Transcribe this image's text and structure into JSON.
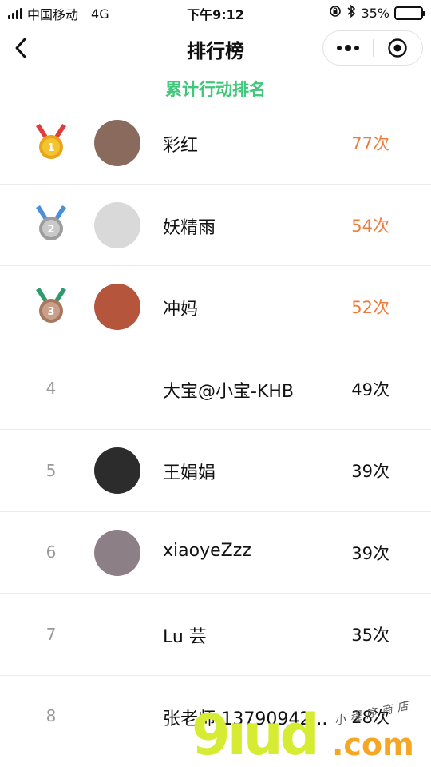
{
  "status_bar": {
    "carrier": "中国移动",
    "network": "4G",
    "time": "下午9:12",
    "battery_percent": "35%",
    "battery_level": 0.35
  },
  "nav": {
    "title": "排行榜",
    "back_icon": "chevron-left-icon",
    "more_icon": "more-dots-icon",
    "close_icon": "target-close-icon"
  },
  "subtitle": "累计行动排名",
  "colors": {
    "accent_green": "#3fc77a",
    "top_count_orange": "#ef7c3c",
    "gold": "#f4c430",
    "silver": "#b7b7b7",
    "bronze": "#c89a7e"
  },
  "rankings": [
    {
      "rank": "1",
      "medal": "gold-medal-icon",
      "name": "彩红",
      "count": "77次",
      "avatar_color": "#8a6a5c"
    },
    {
      "rank": "2",
      "medal": "silver-medal-icon",
      "name": "妖精雨",
      "count": "54次",
      "avatar_color": "#d9d9d9"
    },
    {
      "rank": "3",
      "medal": "bronze-medal-icon",
      "name": "冲妈",
      "count": "52次",
      "avatar_color": "#b5563c"
    },
    {
      "rank": "4",
      "medal": "",
      "name": "大宝@小宝-KHB",
      "count": "49次",
      "avatar_color": "#ffffff"
    },
    {
      "rank": "5",
      "medal": "",
      "name": "王娟娟",
      "count": "39次",
      "avatar_color": "#2c2c2c"
    },
    {
      "rank": "6",
      "medal": "",
      "name": "xiaoyeZzz",
      "count": "39次",
      "avatar_color": "#8c7f86"
    },
    {
      "rank": "7",
      "medal": "",
      "name": "Lu 芸",
      "count": "35次",
      "avatar_color": "#ffffff"
    },
    {
      "rank": "8",
      "medal": "",
      "name": "张老师:13790942...",
      "count": "28次",
      "avatar_color": "#ffffff"
    }
  ],
  "watermark": {
    "main": "9ıud",
    "domain": ".com",
    "handwriting": "小程序商店"
  }
}
